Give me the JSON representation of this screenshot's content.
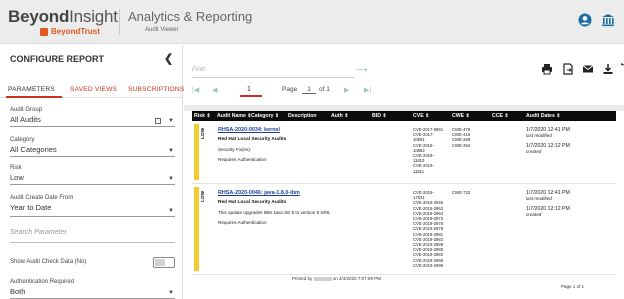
{
  "header": {
    "brand_name_bold": "Beyond",
    "brand_name_rest": "Insight",
    "brand_sub": "BeyondTrust",
    "app_title": "Analytics & Reporting",
    "app_sub": "Audit Viewer",
    "accent": "#1a6fa3"
  },
  "sidebar": {
    "title": "CONFIGURE REPORT",
    "tabs": [
      {
        "label": "PARAMETERS",
        "active": true
      },
      {
        "label": "SAVED VIEWS",
        "active": false
      },
      {
        "label": "SUBSCRIPTIONS",
        "active": false
      }
    ],
    "fields": {
      "audit_group": {
        "label": "Audit Group",
        "value": "All Audits"
      },
      "category": {
        "label": "Category",
        "value": "All Categories"
      },
      "risk": {
        "label": "Risk",
        "value": "Low"
      },
      "create_date": {
        "label": "Audit Create Date From",
        "value": "Year to Date"
      },
      "search": {
        "placeholder": "Search Parameter"
      },
      "show_check": {
        "label": "Show Audit Check Data (No)"
      },
      "auth_required": {
        "label": "Authentication Required",
        "value": "Both"
      }
    }
  },
  "toolbar": {
    "find_placeholder": "Find",
    "find_next": "⟶",
    "icons": [
      "print-icon",
      "export-icon",
      "email-icon",
      "download-icon",
      "refresh-icon"
    ]
  },
  "pager": {
    "first": "|◀",
    "prev": "◀",
    "current": "1",
    "page_label": "Page",
    "page_input": "1",
    "of_label": "of 1",
    "next": "▶",
    "last": "▶|"
  },
  "table": {
    "headers": [
      "Risk ⇕",
      "Audit Name ⇕",
      "Category ⇕",
      "Description",
      "Auth ⇕",
      "BID ⇕",
      "CVE ⇕",
      "CWE ⇕",
      "CCE ⇕",
      "Audit Dates ⇕"
    ],
    "rows": [
      {
        "risk": "LOW",
        "title": "RHSA-2020-0034: kernel",
        "category": "Red Hat Local Security Audits",
        "desc1": "Security Fix(es):",
        "desc2": "Requires Authentication",
        "cves": [
          "CVE-2017-0861",
          "CVE-2017-",
          "10661",
          "CVE-2018-",
          "10852",
          "CVE-2019-",
          "11810",
          "CVE-2019-",
          "11811"
        ],
        "cwes": [
          "CWE-476",
          "CWE-416",
          "CWE-269",
          "CWE-264"
        ],
        "modified": "1/7/2020 12:41 PM",
        "modified_label": "last modified",
        "created": "1/7/2020 12:12 PM",
        "created_label": "created"
      },
      {
        "risk": "LOW",
        "title": "RHSA-2020-0046: java-1.8.0-ibm",
        "category": "Red Hat Local Security Audits",
        "desc1": "This update upgrades IBM Java SE 8 to version 8 SR6.",
        "desc2": "Requires Authentication",
        "cves": [
          "CVE-2019-",
          "17631",
          "CVE-2019-2945",
          "CVE-2019-2962",
          "CVE-2019-2964",
          "CVE-2019-2973",
          "CVE-2019-2975",
          "CVE-2019-2978",
          "CVE-2019-2981",
          "CVE-2019-2983",
          "CVE-2019-2988",
          "CVE-2019-2989",
          "CVE-2019-2992",
          "CVE-2019-2996",
          "CVE-2019-2999"
        ],
        "cwes": [
          "CWE-732"
        ],
        "modified": "1/7/2020 12:41 PM",
        "modified_label": "last modified",
        "created": "1/7/2020 12:12 PM",
        "created_label": "created"
      }
    ]
  },
  "footer": {
    "printed_prefix": "Printed by",
    "printed_suffix": "on 2/4/2020 7:07:09 PM",
    "page": "Page 1 of 1"
  }
}
